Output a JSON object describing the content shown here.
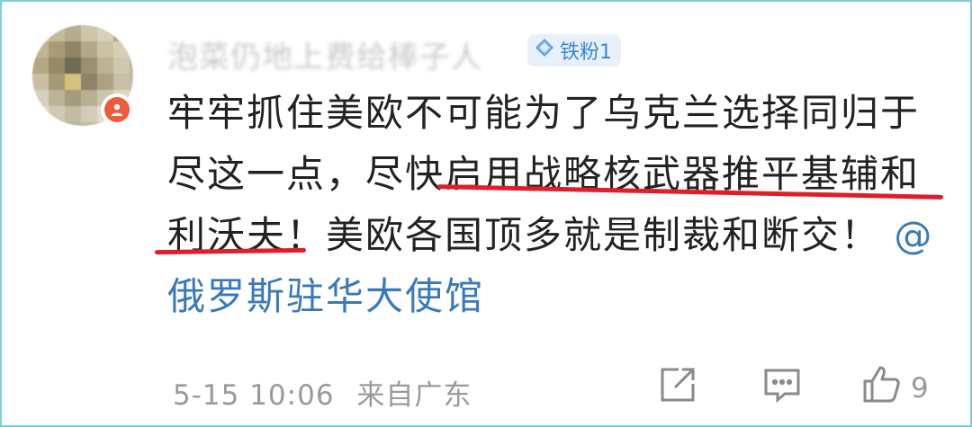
{
  "user": {
    "name": "泡菜仍地上费给棒子人",
    "badge_label": "铁粉1"
  },
  "comment": {
    "line1": "牢牢抓住美欧不可能为了乌克兰选择同归于",
    "line2_a": "尽这一点，尽快",
    "line2_b": "启用战略核武器推平基辅和",
    "line3_a": "利沃夫",
    "line3_b": "！美欧各国顶多就是制裁和断交！",
    "mention_at": "@",
    "mention_name": "俄罗斯驻华大使馆"
  },
  "footer": {
    "timestamp": "5-15 10:06",
    "location": "来自广东",
    "like_count": "9"
  },
  "colors": {
    "highlight": "#e11d2a",
    "mention": "#3a79b8",
    "badge_bg": "#e8f1fb",
    "badge_text": "#3b86d6"
  },
  "icons": [
    "diamond-icon",
    "share-icon",
    "comment-icon",
    "like-icon"
  ]
}
